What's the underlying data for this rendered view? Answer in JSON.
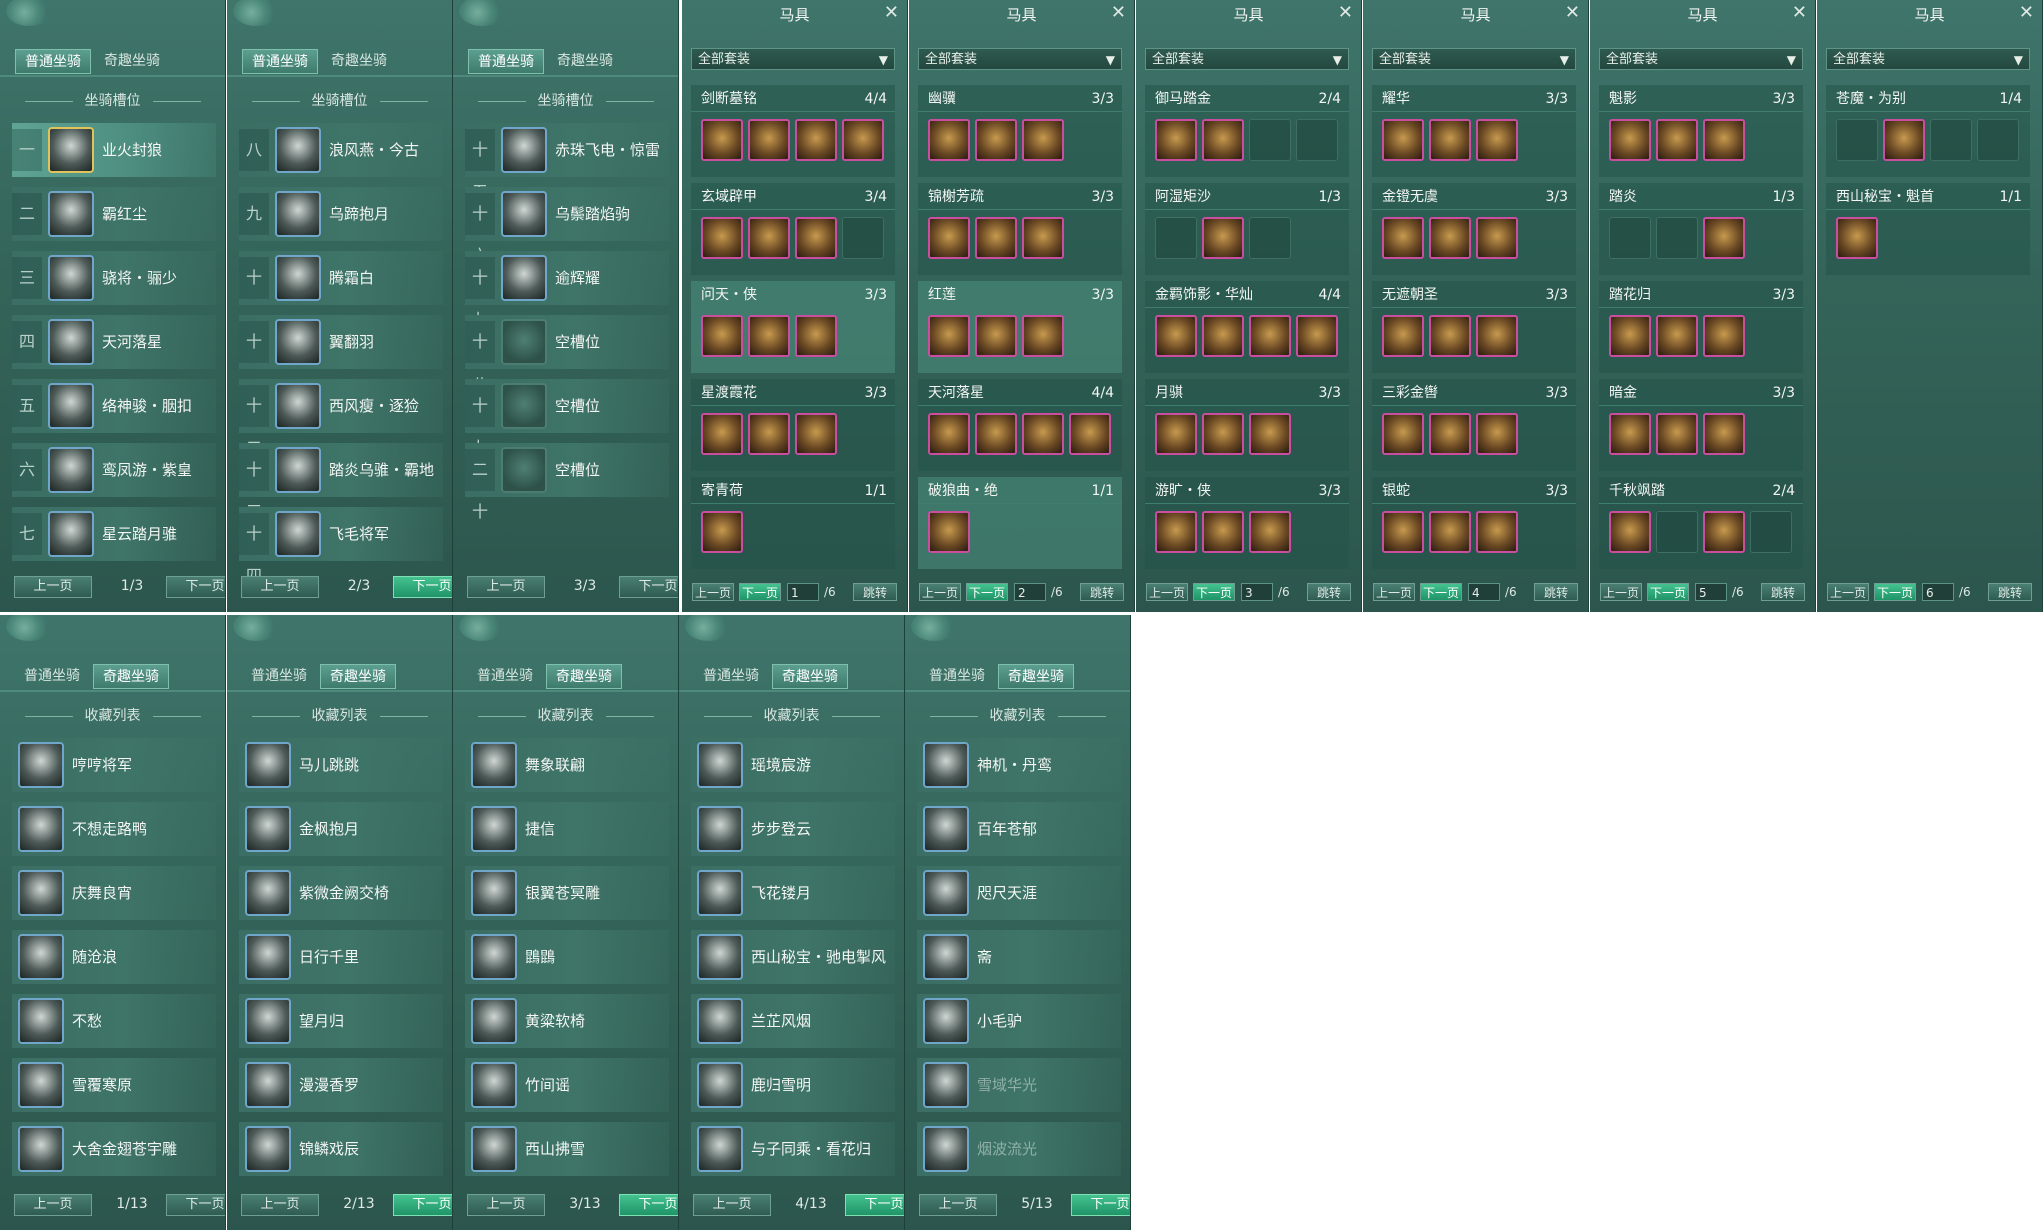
{
  "mount_slot_panels": [
    {
      "tabs": [
        "普通坐骑",
        "奇趣坐骑"
      ],
      "active_tab": 0,
      "section_title": "坐骑槽位",
      "rows": [
        {
          "num": "一",
          "name": "业火封狼",
          "selected": true,
          "empty": false
        },
        {
          "num": "二",
          "name": "霸红尘",
          "selected": false,
          "empty": false
        },
        {
          "num": "三",
          "name": "骁将・骊少",
          "selected": false,
          "empty": false
        },
        {
          "num": "四",
          "name": "天河落星",
          "selected": false,
          "empty": false
        },
        {
          "num": "五",
          "name": "络神骏・胭扣",
          "selected": false,
          "empty": false
        },
        {
          "num": "六",
          "name": "鸾凤游・紫皇",
          "selected": false,
          "empty": false
        },
        {
          "num": "七",
          "name": "星云踏月骓",
          "selected": false,
          "empty": false
        }
      ],
      "pager": {
        "prev": "上一页",
        "page": "1/3",
        "next": "下一页",
        "next_hot": false
      }
    },
    {
      "tabs": [
        "普通坐骑",
        "奇趣坐骑"
      ],
      "active_tab": 0,
      "section_title": "坐骑槽位",
      "rows": [
        {
          "num": "八",
          "name": "浪风燕・今古",
          "selected": false,
          "empty": false
        },
        {
          "num": "九",
          "name": "乌蹄抱月",
          "selected": false,
          "empty": false
        },
        {
          "num": "十",
          "name": "腾霜白",
          "selected": false,
          "empty": false
        },
        {
          "num": "十一",
          "name": "翼翻羽",
          "selected": false,
          "empty": false
        },
        {
          "num": "十二",
          "name": "西风瘦・逐猃",
          "selected": false,
          "empty": false
        },
        {
          "num": "十三",
          "name": "踏炎乌骓・霸地",
          "selected": false,
          "empty": false
        },
        {
          "num": "十四",
          "name": "飞毛将军",
          "selected": false,
          "empty": false
        }
      ],
      "pager": {
        "prev": "上一页",
        "page": "2/3",
        "next": "下一页",
        "next_hot": true
      }
    },
    {
      "tabs": [
        "普通坐骑",
        "奇趣坐骑"
      ],
      "active_tab": 0,
      "section_title": "坐骑槽位",
      "rows": [
        {
          "num": "十五",
          "name": "赤珠飞电・惊雷",
          "selected": false,
          "empty": false
        },
        {
          "num": "十六",
          "name": "乌鬃踏焰驹",
          "selected": false,
          "empty": false
        },
        {
          "num": "十七",
          "name": "逾辉耀",
          "selected": false,
          "empty": false
        },
        {
          "num": "十八",
          "name": "空槽位",
          "selected": false,
          "empty": true
        },
        {
          "num": "十九",
          "name": "空槽位",
          "selected": false,
          "empty": true
        },
        {
          "num": "二十",
          "name": "空槽位",
          "selected": false,
          "empty": true
        }
      ],
      "pager": {
        "prev": "上一页",
        "page": "3/3",
        "next": "下一页",
        "next_hot": false
      }
    }
  ],
  "gear_panels": [
    {
      "title": "马具",
      "filter": "全部套装",
      "sets": [
        {
          "name": "剑断墓铭",
          "count": "4/4",
          "slots": [
            1,
            1,
            1,
            1
          ],
          "hl": false
        },
        {
          "name": "玄域辟甲",
          "count": "3/4",
          "slots": [
            1,
            1,
            1,
            0
          ],
          "hl": false
        },
        {
          "name": "问天・侠",
          "count": "3/3",
          "slots": [
            1,
            1,
            1
          ],
          "hl": true
        },
        {
          "name": "星渡霞花",
          "count": "3/3",
          "slots": [
            1,
            1,
            1
          ],
          "hl": false
        },
        {
          "name": "寄青荷",
          "count": "1/1",
          "slots": [
            1
          ],
          "hl": false
        }
      ],
      "pager": {
        "prev": "上一页",
        "next": "下一页",
        "page": "1",
        "total": "/6",
        "jump": "跳转"
      }
    },
    {
      "title": "马具",
      "filter": "全部套装",
      "sets": [
        {
          "name": "幽骥",
          "count": "3/3",
          "slots": [
            1,
            1,
            1
          ],
          "hl": false
        },
        {
          "name": "锦榭芳疏",
          "count": "3/3",
          "slots": [
            1,
            1,
            1
          ],
          "hl": false
        },
        {
          "name": "红莲",
          "count": "3/3",
          "slots": [
            1,
            1,
            1
          ],
          "hl": true
        },
        {
          "name": "天河落星",
          "count": "4/4",
          "slots": [
            1,
            1,
            1,
            1
          ],
          "hl": false
        },
        {
          "name": "破狼曲・绝",
          "count": "1/1",
          "slots": [
            1
          ],
          "hl": true
        }
      ],
      "pager": {
        "prev": "上一页",
        "next": "下一页",
        "page": "2",
        "total": "/6",
        "jump": "跳转"
      }
    },
    {
      "title": "马具",
      "filter": "全部套装",
      "sets": [
        {
          "name": "御马踏金",
          "count": "2/4",
          "slots": [
            1,
            1,
            0,
            0
          ],
          "hl": false
        },
        {
          "name": "阿湿矩沙",
          "count": "1/3",
          "slots": [
            0,
            1,
            0
          ],
          "hl": false
        },
        {
          "name": "金羁饰影・华灿",
          "count": "4/4",
          "slots": [
            1,
            1,
            1,
            1
          ],
          "hl": false
        },
        {
          "name": "月骐",
          "count": "3/3",
          "slots": [
            1,
            1,
            1
          ],
          "hl": false
        },
        {
          "name": "游旷・侠",
          "count": "3/3",
          "slots": [
            1,
            1,
            1
          ],
          "hl": false
        }
      ],
      "pager": {
        "prev": "上一页",
        "next": "下一页",
        "page": "3",
        "total": "/6",
        "jump": "跳转"
      }
    },
    {
      "title": "马具",
      "filter": "全部套装",
      "sets": [
        {
          "name": "耀华",
          "count": "3/3",
          "slots": [
            1,
            1,
            1
          ],
          "hl": false
        },
        {
          "name": "金镫无虞",
          "count": "3/3",
          "slots": [
            1,
            1,
            1
          ],
          "hl": false
        },
        {
          "name": "无遮朝圣",
          "count": "3/3",
          "slots": [
            1,
            1,
            1
          ],
          "hl": false
        },
        {
          "name": "三彩金辔",
          "count": "3/3",
          "slots": [
            1,
            1,
            1
          ],
          "hl": false
        },
        {
          "name": "银蛇",
          "count": "3/3",
          "slots": [
            1,
            1,
            1
          ],
          "hl": false
        }
      ],
      "pager": {
        "prev": "上一页",
        "next": "下一页",
        "page": "4",
        "total": "/6",
        "jump": "跳转"
      }
    },
    {
      "title": "马具",
      "filter": "全部套装",
      "sets": [
        {
          "name": "魁影",
          "count": "3/3",
          "slots": [
            1,
            1,
            1
          ],
          "hl": false
        },
        {
          "name": "踏炎",
          "count": "1/3",
          "slots": [
            0,
            0,
            1
          ],
          "hl": false
        },
        {
          "name": "踏花归",
          "count": "3/3",
          "slots": [
            1,
            1,
            1
          ],
          "hl": false
        },
        {
          "name": "暗金",
          "count": "3/3",
          "slots": [
            1,
            1,
            1
          ],
          "hl": false
        },
        {
          "name": "千秋飒踏",
          "count": "2/4",
          "slots": [
            1,
            0,
            1,
            0
          ],
          "hl": false
        }
      ],
      "pager": {
        "prev": "上一页",
        "next": "下一页",
        "page": "5",
        "total": "/6",
        "jump": "跳转"
      }
    },
    {
      "title": "马具",
      "filter": "全部套装",
      "sets": [
        {
          "name": "苍魔・为别",
          "count": "1/4",
          "slots": [
            0,
            1,
            0,
            0
          ],
          "hl": false
        },
        {
          "name": "西山秘宝・魁首",
          "count": "1/1",
          "slots": [
            1
          ],
          "hl": false
        }
      ],
      "pager": {
        "prev": "上一页",
        "next": "下一页",
        "page": "6",
        "total": "/6",
        "jump": "跳转"
      }
    }
  ],
  "collection_panels": [
    {
      "tabs": [
        "普通坐骑",
        "奇趣坐骑"
      ],
      "active_tab": 1,
      "section_title": "收藏列表",
      "rows": [
        {
          "name": "哼哼将军",
          "dim": false
        },
        {
          "name": "不想走路鸭",
          "dim": false
        },
        {
          "name": "庆舞良宵",
          "dim": false
        },
        {
          "name": "随沧浪",
          "dim": false
        },
        {
          "name": "不愁",
          "dim": false
        },
        {
          "name": "雪覆寒原",
          "dim": false
        },
        {
          "name": "大舍金翅苍宇雕",
          "dim": false
        }
      ],
      "pager": {
        "prev": "上一页",
        "page": "1/13",
        "next": "下一页",
        "next_hot": false
      }
    },
    {
      "tabs": [
        "普通坐骑",
        "奇趣坐骑"
      ],
      "active_tab": 1,
      "section_title": "收藏列表",
      "rows": [
        {
          "name": "马儿跳跳",
          "dim": false
        },
        {
          "name": "金枫抱月",
          "dim": false
        },
        {
          "name": "紫微金阙交椅",
          "dim": false
        },
        {
          "name": "日行千里",
          "dim": false
        },
        {
          "name": "望月归",
          "dim": false
        },
        {
          "name": "漫漫香罗",
          "dim": false
        },
        {
          "name": "锦鳞戏辰",
          "dim": false
        }
      ],
      "pager": {
        "prev": "上一页",
        "page": "2/13",
        "next": "下一页",
        "next_hot": true
      }
    },
    {
      "tabs": [
        "普通坐骑",
        "奇趣坐骑"
      ],
      "active_tab": 1,
      "section_title": "收藏列表",
      "rows": [
        {
          "name": "舞象联翩",
          "dim": false
        },
        {
          "name": "捷信",
          "dim": false
        },
        {
          "name": "银翼苍冥雕",
          "dim": false
        },
        {
          "name": "鵾鵾",
          "dim": false
        },
        {
          "name": "黄粱软椅",
          "dim": false
        },
        {
          "name": "竹间谣",
          "dim": false
        },
        {
          "name": "西山拂雪",
          "dim": false
        }
      ],
      "pager": {
        "prev": "上一页",
        "page": "3/13",
        "next": "下一页",
        "next_hot": true
      }
    },
    {
      "tabs": [
        "普通坐骑",
        "奇趣坐骑"
      ],
      "active_tab": 1,
      "section_title": "收藏列表",
      "rows": [
        {
          "name": "瑶境宸游",
          "dim": false
        },
        {
          "name": "步步登云",
          "dim": false
        },
        {
          "name": "飞花镂月",
          "dim": false
        },
        {
          "name": "西山秘宝・驰电掣风",
          "dim": false
        },
        {
          "name": "兰芷风烟",
          "dim": false
        },
        {
          "name": "鹿归雪明",
          "dim": false
        },
        {
          "name": "与子同乘・看花归",
          "dim": false
        }
      ],
      "pager": {
        "prev": "上一页",
        "page": "4/13",
        "next": "下一页",
        "next_hot": true
      }
    },
    {
      "tabs": [
        "普通坐骑",
        "奇趣坐骑"
      ],
      "active_tab": 1,
      "section_title": "收藏列表",
      "rows": [
        {
          "name": "神机・丹鸾",
          "dim": false
        },
        {
          "name": "百年苍郁",
          "dim": false
        },
        {
          "name": "咫尺天涯",
          "dim": false
        },
        {
          "name": "斋",
          "dim": false
        },
        {
          "name": "小毛驴",
          "dim": false
        },
        {
          "name": "雪域华光",
          "dim": true
        },
        {
          "name": "烟波流光",
          "dim": true
        }
      ],
      "pager": {
        "prev": "上一页",
        "page": "5/13",
        "next": "下一页",
        "next_hot": true
      }
    }
  ],
  "colors": {
    "panel_bg": "#346459",
    "tab_active": "#4c8d7f",
    "hot_button": "#1f9468",
    "slot_border": "#c94ea0",
    "avatar_border": "#6fa6c9"
  },
  "icons": {
    "close": "close-icon",
    "dropdown": "chevron-down-icon",
    "decoration": "cloud-ornament-icon",
    "cursor": "hand-cursor-icon"
  }
}
